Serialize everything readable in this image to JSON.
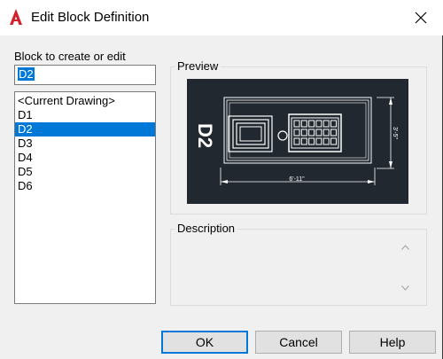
{
  "window": {
    "title": "Edit Block Definition",
    "app_icon": "autocad-icon",
    "close_icon": "close-icon"
  },
  "block_select": {
    "label": "Block to create or edit",
    "input_value": "D2",
    "items": [
      "<Current Drawing>",
      "D1",
      "D2",
      "D3",
      "D4",
      "D5",
      "D6"
    ],
    "selected_index": 2
  },
  "preview": {
    "label": "Preview",
    "block_name": "D2",
    "dim_width": "6'-11\"",
    "dim_height": "3'-5\""
  },
  "description": {
    "label": "Description",
    "scroll_up_icon": "chevron-up-icon",
    "scroll_down_icon": "chevron-down-icon"
  },
  "buttons": {
    "ok": "OK",
    "cancel": "Cancel",
    "help": "Help"
  },
  "colors": {
    "accent": "#0078d7",
    "dialog_bg": "#f0f0f0",
    "preview_bg": "#212830",
    "autocad_red": "#d4202a"
  }
}
